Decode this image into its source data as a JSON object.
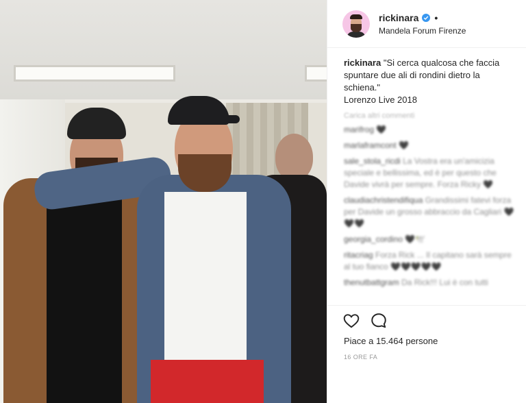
{
  "post": {
    "username": "rickinara",
    "verified_color": "#3897f0",
    "separator": "•",
    "location": "Mandela Forum Firenze",
    "caption": {
      "username": "rickinara",
      "text": "\"Si cerca qualcosa che faccia spuntare due ali di rondini dietro la schiena.\"",
      "tag_line": "Lorenzo Live 2018"
    },
    "load_more": "Carica altri commenti",
    "likes": "Piace a 15.464 persone",
    "time": "16 ORE FA"
  },
  "comments": [
    {
      "user": "marifrog",
      "text": "🖤"
    },
    {
      "user": "marlaframcont",
      "text": "🖤"
    },
    {
      "user": "sale_stola_ricdi",
      "text": "La Vostra era un'amicizia speciale e bellissima, ed è per questo che Davide vivrà per sempre. Forza Ricky 🖤"
    },
    {
      "user": "claudiachristendifiqua",
      "text": "Grandissimi fatevi forza per Davide un grosso abbraccio da Cagliari 🖤🖤🖤"
    },
    {
      "user": "georgia_cordino",
      "text": "🖤🕊️"
    },
    {
      "user": "ritacriag",
      "text": "Forza Rick ... Il capitano sarà sempre al tuo fianco 🖤🖤🖤🖤🖤"
    },
    {
      "user": "thenutbattgram",
      "text": "Da Rick!!! Lui è con tutti"
    }
  ],
  "colors": {
    "avatar_bg": "#f6c6e6",
    "text": "#262626",
    "muted": "#8e8e8e"
  },
  "icons": {
    "like": "heart-outline-icon",
    "comment": "speech-bubble-icon",
    "verified": "verified-check-icon"
  }
}
